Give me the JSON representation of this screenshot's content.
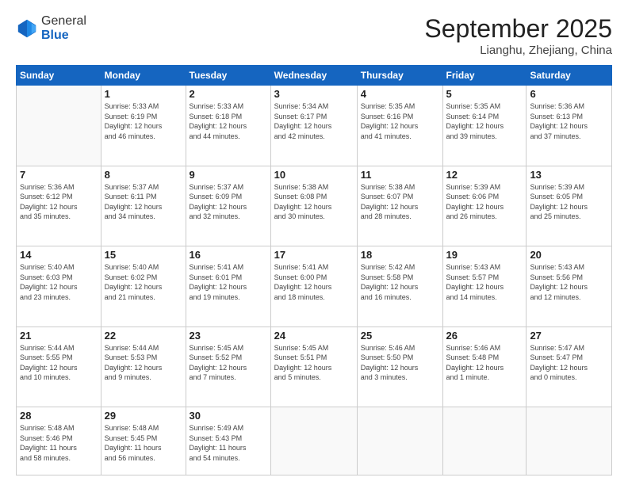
{
  "header": {
    "logo": {
      "line1": "General",
      "line2": "Blue"
    },
    "title": "September 2025",
    "location": "Lianghu, Zhejiang, China"
  },
  "weekdays": [
    "Sunday",
    "Monday",
    "Tuesday",
    "Wednesday",
    "Thursday",
    "Friday",
    "Saturday"
  ],
  "weeks": [
    [
      {
        "day": "",
        "info": ""
      },
      {
        "day": "1",
        "info": "Sunrise: 5:33 AM\nSunset: 6:19 PM\nDaylight: 12 hours\nand 46 minutes."
      },
      {
        "day": "2",
        "info": "Sunrise: 5:33 AM\nSunset: 6:18 PM\nDaylight: 12 hours\nand 44 minutes."
      },
      {
        "day": "3",
        "info": "Sunrise: 5:34 AM\nSunset: 6:17 PM\nDaylight: 12 hours\nand 42 minutes."
      },
      {
        "day": "4",
        "info": "Sunrise: 5:35 AM\nSunset: 6:16 PM\nDaylight: 12 hours\nand 41 minutes."
      },
      {
        "day": "5",
        "info": "Sunrise: 5:35 AM\nSunset: 6:14 PM\nDaylight: 12 hours\nand 39 minutes."
      },
      {
        "day": "6",
        "info": "Sunrise: 5:36 AM\nSunset: 6:13 PM\nDaylight: 12 hours\nand 37 minutes."
      }
    ],
    [
      {
        "day": "7",
        "info": "Sunrise: 5:36 AM\nSunset: 6:12 PM\nDaylight: 12 hours\nand 35 minutes."
      },
      {
        "day": "8",
        "info": "Sunrise: 5:37 AM\nSunset: 6:11 PM\nDaylight: 12 hours\nand 34 minutes."
      },
      {
        "day": "9",
        "info": "Sunrise: 5:37 AM\nSunset: 6:09 PM\nDaylight: 12 hours\nand 32 minutes."
      },
      {
        "day": "10",
        "info": "Sunrise: 5:38 AM\nSunset: 6:08 PM\nDaylight: 12 hours\nand 30 minutes."
      },
      {
        "day": "11",
        "info": "Sunrise: 5:38 AM\nSunset: 6:07 PM\nDaylight: 12 hours\nand 28 minutes."
      },
      {
        "day": "12",
        "info": "Sunrise: 5:39 AM\nSunset: 6:06 PM\nDaylight: 12 hours\nand 26 minutes."
      },
      {
        "day": "13",
        "info": "Sunrise: 5:39 AM\nSunset: 6:05 PM\nDaylight: 12 hours\nand 25 minutes."
      }
    ],
    [
      {
        "day": "14",
        "info": "Sunrise: 5:40 AM\nSunset: 6:03 PM\nDaylight: 12 hours\nand 23 minutes."
      },
      {
        "day": "15",
        "info": "Sunrise: 5:40 AM\nSunset: 6:02 PM\nDaylight: 12 hours\nand 21 minutes."
      },
      {
        "day": "16",
        "info": "Sunrise: 5:41 AM\nSunset: 6:01 PM\nDaylight: 12 hours\nand 19 minutes."
      },
      {
        "day": "17",
        "info": "Sunrise: 5:41 AM\nSunset: 6:00 PM\nDaylight: 12 hours\nand 18 minutes."
      },
      {
        "day": "18",
        "info": "Sunrise: 5:42 AM\nSunset: 5:58 PM\nDaylight: 12 hours\nand 16 minutes."
      },
      {
        "day": "19",
        "info": "Sunrise: 5:43 AM\nSunset: 5:57 PM\nDaylight: 12 hours\nand 14 minutes."
      },
      {
        "day": "20",
        "info": "Sunrise: 5:43 AM\nSunset: 5:56 PM\nDaylight: 12 hours\nand 12 minutes."
      }
    ],
    [
      {
        "day": "21",
        "info": "Sunrise: 5:44 AM\nSunset: 5:55 PM\nDaylight: 12 hours\nand 10 minutes."
      },
      {
        "day": "22",
        "info": "Sunrise: 5:44 AM\nSunset: 5:53 PM\nDaylight: 12 hours\nand 9 minutes."
      },
      {
        "day": "23",
        "info": "Sunrise: 5:45 AM\nSunset: 5:52 PM\nDaylight: 12 hours\nand 7 minutes."
      },
      {
        "day": "24",
        "info": "Sunrise: 5:45 AM\nSunset: 5:51 PM\nDaylight: 12 hours\nand 5 minutes."
      },
      {
        "day": "25",
        "info": "Sunrise: 5:46 AM\nSunset: 5:50 PM\nDaylight: 12 hours\nand 3 minutes."
      },
      {
        "day": "26",
        "info": "Sunrise: 5:46 AM\nSunset: 5:48 PM\nDaylight: 12 hours\nand 1 minute."
      },
      {
        "day": "27",
        "info": "Sunrise: 5:47 AM\nSunset: 5:47 PM\nDaylight: 12 hours\nand 0 minutes."
      }
    ],
    [
      {
        "day": "28",
        "info": "Sunrise: 5:48 AM\nSunset: 5:46 PM\nDaylight: 11 hours\nand 58 minutes."
      },
      {
        "day": "29",
        "info": "Sunrise: 5:48 AM\nSunset: 5:45 PM\nDaylight: 11 hours\nand 56 minutes."
      },
      {
        "day": "30",
        "info": "Sunrise: 5:49 AM\nSunset: 5:43 PM\nDaylight: 11 hours\nand 54 minutes."
      },
      {
        "day": "",
        "info": ""
      },
      {
        "day": "",
        "info": ""
      },
      {
        "day": "",
        "info": ""
      },
      {
        "day": "",
        "info": ""
      }
    ]
  ]
}
